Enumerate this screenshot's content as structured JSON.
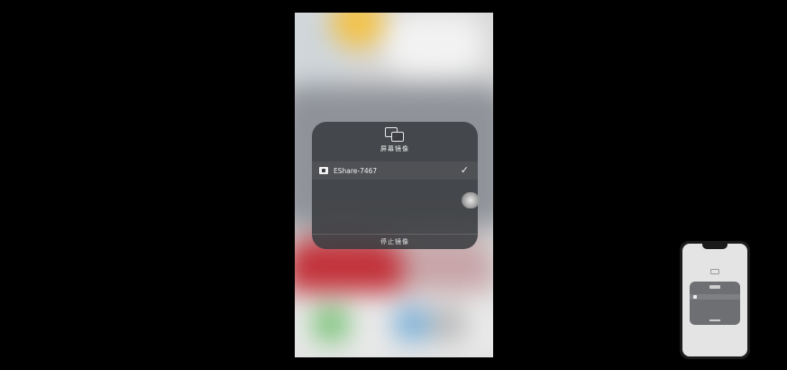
{
  "screen_mirroring": {
    "icon": "screen-mirroring-icon",
    "title": "屏幕镜像",
    "device": {
      "icon": "appletv-icon",
      "name": "EShare-7467",
      "selected_icon": "checkmark-icon",
      "check_glyph": "✓"
    },
    "stop_label": "停止镜像"
  },
  "colors": {
    "background": "#000000",
    "panel": "#3a3c40",
    "text": "#f2f2f2"
  }
}
